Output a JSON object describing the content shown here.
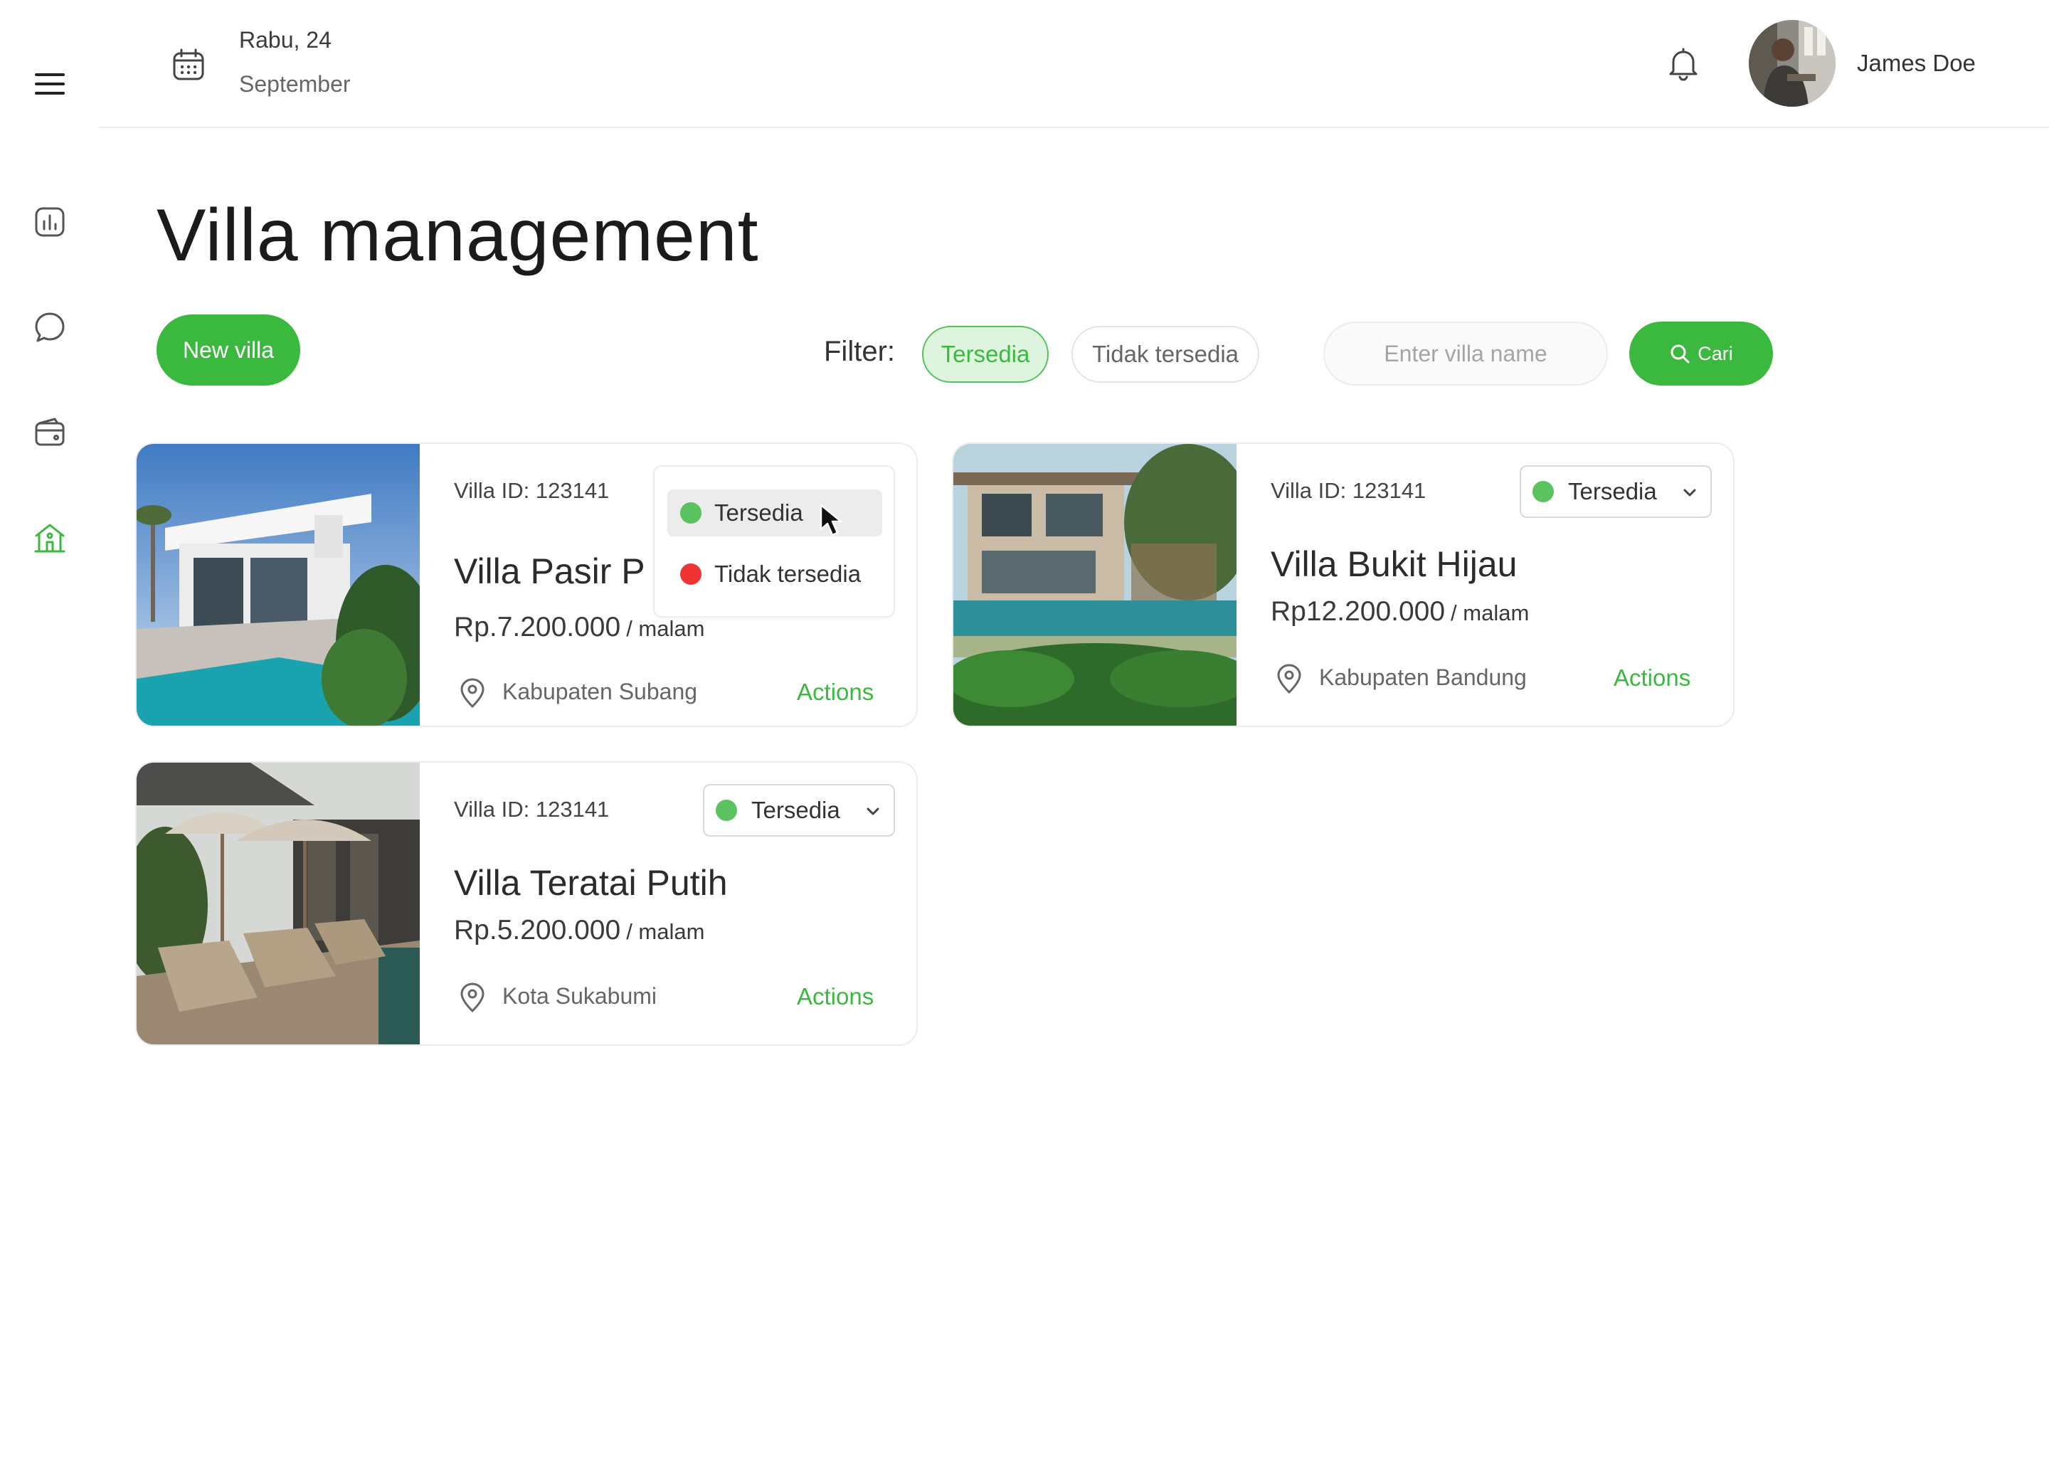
{
  "header": {
    "date_line1": "Rabu, 24",
    "date_line2": "September",
    "user_name": "James Doe"
  },
  "sidebar": {
    "items": [
      {
        "icon": "bar-chart-icon",
        "active": false
      },
      {
        "icon": "chat-icon",
        "active": false
      },
      {
        "icon": "wallet-icon",
        "active": false
      },
      {
        "icon": "home-icon",
        "active": true
      }
    ]
  },
  "page": {
    "title": "Villa management",
    "new_button": "New villa",
    "filter_label": "Filter:",
    "filters": [
      "Tersedia",
      "Tidak tersedia"
    ],
    "active_filter": "Tersedia",
    "search_placeholder": "Enter villa name",
    "search_button": "Cari"
  },
  "villas": [
    {
      "id_label": "Villa ID: 123141",
      "name": "Villa Pasir P",
      "price": "Rp.7.200.000",
      "unit": "/ malam",
      "location": "Kabupaten Subang",
      "actions": "Actions",
      "status": "Tersedia",
      "dropdown_open": true
    },
    {
      "id_label": "Villa ID: 123141",
      "name": "Villa Bukit Hijau",
      "price": "Rp12.200.000",
      "unit": "/ malam",
      "location": "Kabupaten Bandung",
      "actions": "Actions",
      "status": "Tersedia"
    },
    {
      "id_label": "Villa ID: 123141",
      "name": "Villa Teratai Putih",
      "price": "Rp.5.200.000",
      "unit": "/ malam",
      "location": "Kota Sukabumi",
      "actions": "Actions",
      "status": "Tersedia"
    }
  ],
  "status_options": [
    {
      "label": "Tersedia",
      "color": "#5ac35f"
    },
    {
      "label": "Tidak tersedia",
      "color": "#ee3434"
    }
  ],
  "colors": {
    "accent": "#3bb93f",
    "available": "#5ac35f",
    "unavailable": "#ee3434"
  }
}
